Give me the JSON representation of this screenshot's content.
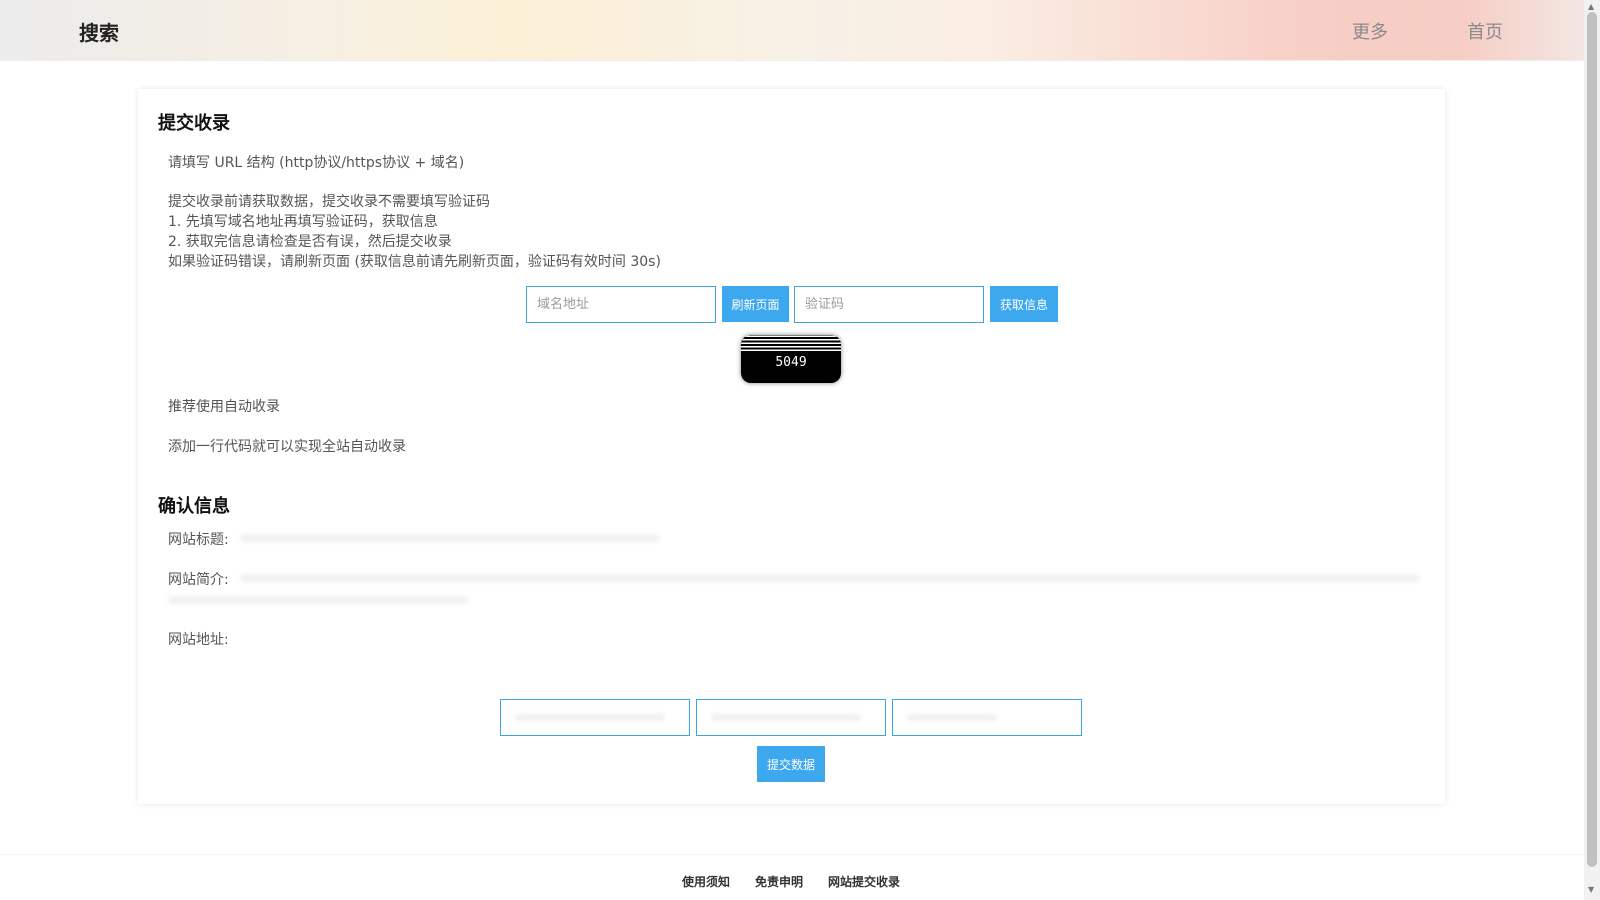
{
  "header": {
    "brand": "搜索",
    "nav": {
      "more": "更多",
      "home": "首页"
    }
  },
  "submit_section": {
    "title": "提交收录",
    "url_hint": "请填写 URL 结构 (http协议/https协议 + 域名)",
    "instructions": [
      "提交收录前请获取数据，提交收录不需要填写验证码",
      "1. 先填写域名地址再填写验证码，获取信息",
      "2. 获取完信息请检查是否有误，然后提交收录",
      "如果验证码错误，请刷新页面 (获取信息前请先刷新页面，验证码有效时间 30s)"
    ],
    "domain_placeholder": "域名地址",
    "refresh_label": "刷新页面",
    "captcha_placeholder": "验证码",
    "fetch_label": "获取信息",
    "captcha_code": "5049",
    "auto_recommend": "推荐使用自动收录",
    "auto_desc": "添加一行代码就可以实现全站自动收录"
  },
  "confirm_section": {
    "title": "确认信息",
    "site_title_label": "网站标题:",
    "site_desc_label": "网站简介:",
    "site_url_label": "网站地址:",
    "submit_label": "提交数据"
  },
  "footer": {
    "links": [
      "使用须知",
      "免责申明",
      "网站提交收录"
    ]
  },
  "colors": {
    "accent": "#3ea8ee",
    "input_border": "#3da5e6"
  }
}
